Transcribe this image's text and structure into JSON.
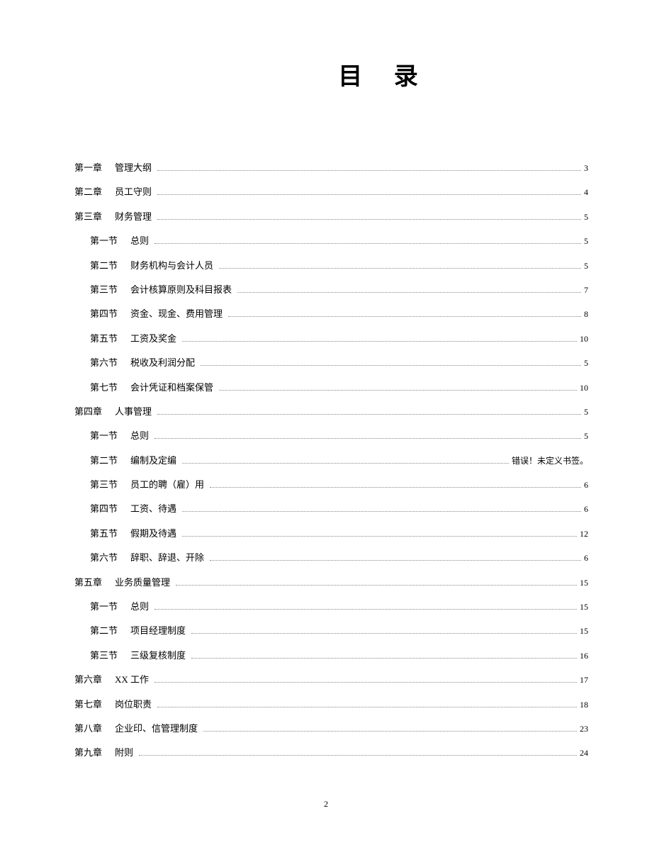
{
  "title": "目 录",
  "page_number": "2",
  "entries": [
    {
      "level": 1,
      "label": "第一章",
      "title": "管理大纲",
      "page": "3"
    },
    {
      "level": 1,
      "label": "第二章",
      "title": "员工守则",
      "page": "4"
    },
    {
      "level": 1,
      "label": "第三章",
      "title": "财务管理",
      "page": "5"
    },
    {
      "level": 2,
      "label": "第一节",
      "title": "总则",
      "page": "5"
    },
    {
      "level": 2,
      "label": "第二节",
      "title": "财务机构与会计人员",
      "page": "5"
    },
    {
      "level": 2,
      "label": "第三节",
      "title": "会计核算原则及科目报表",
      "page": "7"
    },
    {
      "level": 2,
      "label": "第四节",
      "title": "资金、现金、费用管理",
      "page": "8"
    },
    {
      "level": 2,
      "label": "第五节",
      "title": "工资及奖金",
      "page": "10"
    },
    {
      "level": 2,
      "label": "第六节",
      "title": "税收及利润分配",
      "page": "5"
    },
    {
      "level": 2,
      "label": "第七节",
      "title": "会计凭证和档案保管",
      "page": "10"
    },
    {
      "level": 1,
      "label": "第四章",
      "title": "人事管理",
      "page": "5"
    },
    {
      "level": 2,
      "label": "第一节",
      "title": "总则",
      "page": "5"
    },
    {
      "level": 2,
      "label": "第二节",
      "title": "编制及定编",
      "page": "错误！未定义书签。",
      "no_leader": false
    },
    {
      "level": 2,
      "label": "第三节",
      "title": "员工的聘（雇）用",
      "page": "6"
    },
    {
      "level": 2,
      "label": "第四节",
      "title": " 工资、待遇",
      "page": "6"
    },
    {
      "level": 2,
      "label": "第五节",
      "title": "假期及待遇",
      "page": "12"
    },
    {
      "level": 2,
      "label": "第六节",
      "title": "辞职、辞退、开除",
      "page": "6"
    },
    {
      "level": 1,
      "label": "第五章",
      "title": "业务质量管理",
      "page": "15"
    },
    {
      "level": 2,
      "label": "第一节",
      "title": " 总则",
      "page": "15"
    },
    {
      "level": 2,
      "label": "第二节",
      "title": " 项目经理制度",
      "page": "15"
    },
    {
      "level": 2,
      "label": "第三节",
      "title": " 三级复核制度",
      "page": "16"
    },
    {
      "level": 1,
      "label": "第六章",
      "title": "XX 工作",
      "page": "17"
    },
    {
      "level": 1,
      "label": "第七章",
      "title": "岗位职责",
      "page": "18"
    },
    {
      "level": 1,
      "label": "第八章",
      "title": "企业印、信管理制度",
      "page": "23"
    },
    {
      "level": 1,
      "label": "第九章",
      "title": " 附则",
      "page": "24"
    }
  ]
}
